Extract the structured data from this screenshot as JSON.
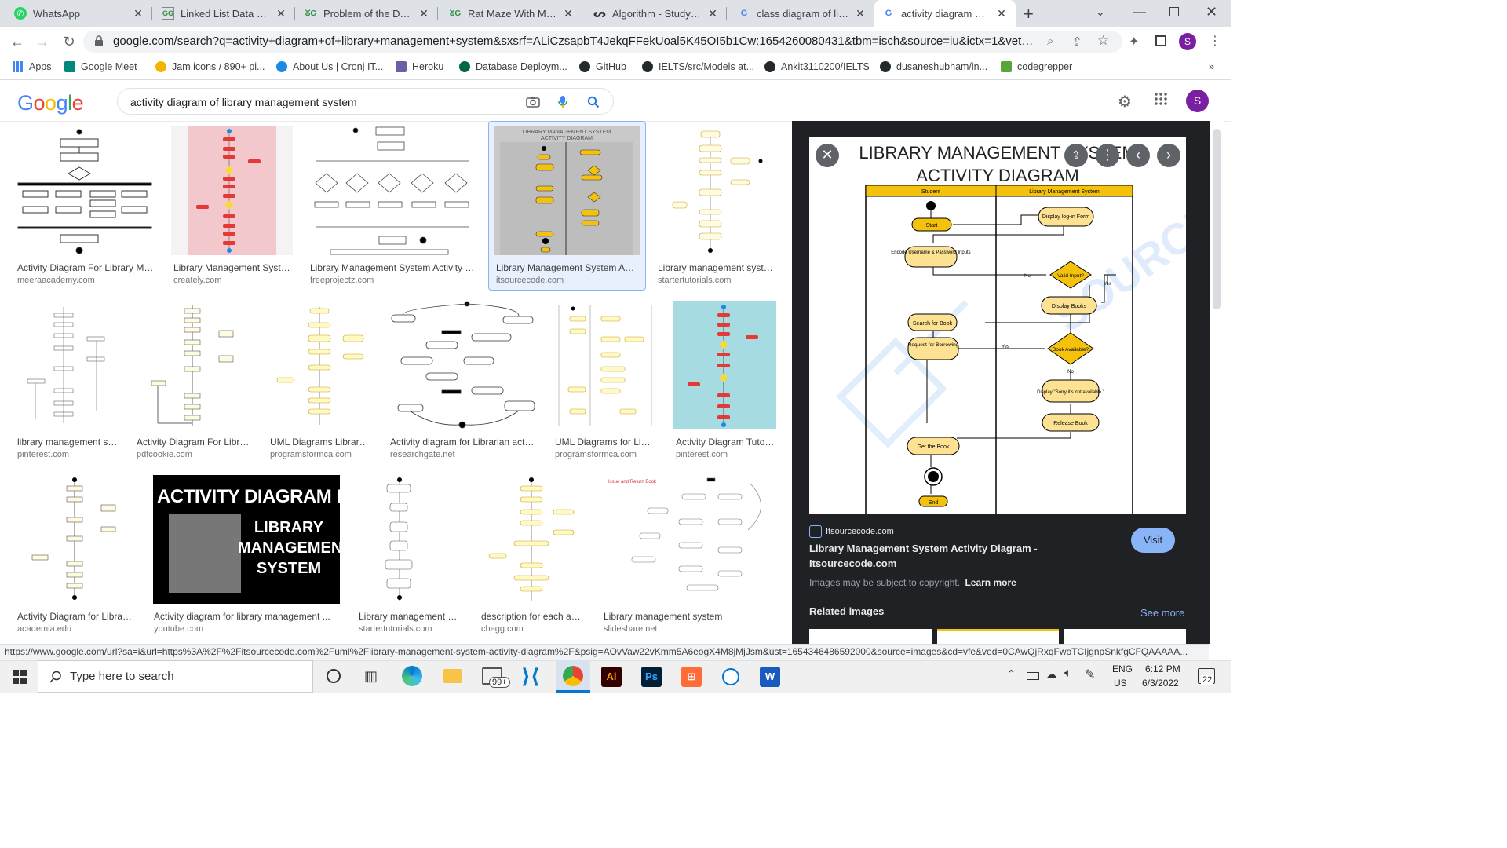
{
  "tabs": [
    {
      "title": "WhatsApp",
      "icon": "whatsapp-icon",
      "active": false
    },
    {
      "title": "Linked List Data Struc",
      "icon": "gfg-icon",
      "active": false
    },
    {
      "title": "Problem of the Day | G",
      "icon": "gfg-icon",
      "active": false
    },
    {
      "title": "Rat Maze With Multip",
      "icon": "gfg-icon",
      "active": false
    },
    {
      "title": "Algorithm - Study Pla",
      "icon": "leetcode-icon",
      "active": false
    },
    {
      "title": "class diagram of libra",
      "icon": "google-icon",
      "active": false
    },
    {
      "title": "activity diagram of lib",
      "icon": "google-icon",
      "active": true
    }
  ],
  "address_bar": {
    "url": "google.com/search?q=activity+diagram+of+library+management+system&sxsrf=ALiCzsapbT4JekqFFekUoal5K45OI5b1Cw:1654260080431&tbm=isch&source=iu&ictx=1&vet=1&fir=..."
  },
  "profile_initial": "S",
  "bookmarks": [
    {
      "label": "Apps",
      "color": "#4285f4"
    },
    {
      "label": "Google Meet",
      "color": "#00897b"
    },
    {
      "label": "Jam icons / 890+ pi...",
      "color": "#f4b400"
    },
    {
      "label": "About Us | Cronj IT...",
      "color": "#1e88e5"
    },
    {
      "label": "Heroku",
      "color": "#6762a6"
    },
    {
      "label": "Database Deploym...",
      "color": "#00684a"
    },
    {
      "label": "GitHub",
      "color": "#24292e"
    },
    {
      "label": "IELTS/src/Models at...",
      "color": "#24292e"
    },
    {
      "label": "Ankit3110200/IELTS",
      "color": "#24292e"
    },
    {
      "label": "dusaneshubham/in...",
      "color": "#24292e"
    },
    {
      "label": "codegrepper",
      "color": "#57a639"
    }
  ],
  "bookmarks_overflow": "»",
  "search": {
    "query": "activity diagram of library management system",
    "logo": "Google"
  },
  "results": [
    {
      "title": "Activity Diagram For Library Man...",
      "source": "meeraacademy.com"
    },
    {
      "title": "Library Management Syste...",
      "source": "creately.com"
    },
    {
      "title": "Library Management System Activity U...",
      "source": "freeprojectz.com"
    },
    {
      "title": "Library Management System Acti...",
      "source": "itsourcecode.com"
    },
    {
      "title": "Library management syste...",
      "source": "startertutorials.com"
    },
    {
      "title": "library management sy...",
      "source": "pinterest.com"
    },
    {
      "title": "Activity Diagram For Librar...",
      "source": "pdfcookie.com"
    },
    {
      "title": "UML Diagrams Library ...",
      "source": "programsformca.com"
    },
    {
      "title": "Activity diagram for Librarian actor...",
      "source": "researchgate.net"
    },
    {
      "title": "UML Diagrams for Libr...",
      "source": "programsformca.com"
    },
    {
      "title": "Activity Diagram Tutori...",
      "source": "pinterest.com"
    },
    {
      "title": "Activity Diagram for Library...",
      "source": "academia.edu"
    },
    {
      "title": "Activity diagram for library management ...",
      "source": "youtube.com"
    },
    {
      "title": "Library management sy...",
      "source": "startertutorials.com"
    },
    {
      "title": "description for each act...",
      "source": "chegg.com"
    },
    {
      "title": "Library management system",
      "source": "slideshare.net"
    }
  ],
  "youtube_thumb": {
    "line1": "ACTIVITY DIAGRAM FOR",
    "line2": "LIBRARY",
    "line3": "MANAGEMENT",
    "line4": "SYSTEM"
  },
  "panel": {
    "diagram_title_1": "LIBRARY MANAGEMENT SYSTEM",
    "diagram_title_2": "ACTIVITY DIAGRAM",
    "lane_left": "Student",
    "lane_right": "Library Management System",
    "nodes": {
      "start": "Start",
      "display_login": "Display log-in Form",
      "encode": "Encode Username & Password Inputs",
      "valid": "Valid Input?",
      "no1": "No",
      "yes1": "Yes",
      "display_books": "Display Books",
      "search": "Search for Book",
      "request": "Request for Borrowing",
      "available": "Book Available?",
      "yes2": "Yes",
      "no2": "No",
      "sorry": "Display \"Sorry it's not available.\"",
      "release": "Release Book",
      "get": "Get the Book",
      "end": "End"
    },
    "site": "Itsourcecode.com",
    "title": "Library Management System Activity Diagram - Itsourcecode.com",
    "copyright": "Images may be subject to copyright.",
    "learn_more": "Learn more",
    "visit": "Visit",
    "related": "Related images",
    "see_more": "See more"
  },
  "status_url": "https://www.google.com/url?sa=i&url=https%3A%2F%2Fitsourcecode.com%2Fuml%2Flibrary-management-system-activity-diagram%2F&psig=AOvVaw22vKmm5A6eogX4M8jMjJsm&ust=1654346486592000&source=images&cd=vfe&ved=0CAwQjRxqFwoTCIjgnpSnkfgCFQAAAAA...",
  "taskbar": {
    "search_placeholder": "Type here to search",
    "mail_badge": "99+",
    "lang_1": "ENG",
    "lang_2": "US",
    "time": "6:12 PM",
    "date": "6/3/2022",
    "notif_badge": "22"
  }
}
